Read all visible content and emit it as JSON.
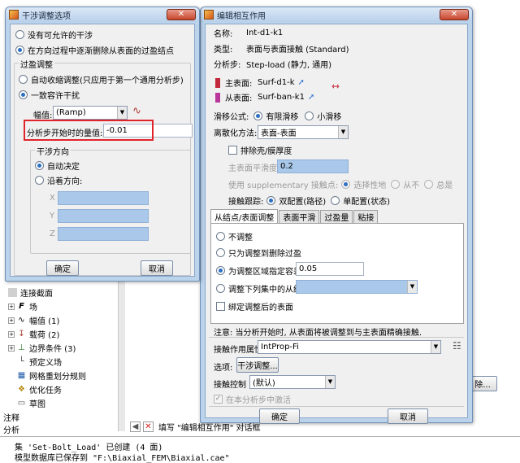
{
  "background": {
    "tree": [
      {
        "label": "连接截面",
        "icon": "connector-section-icon"
      },
      {
        "label": "场",
        "icon": "field-icon"
      },
      {
        "label": "幅值 (1)",
        "icon": "amplitude-icon"
      },
      {
        "label": "载荷 (2)",
        "icon": "load-icon"
      },
      {
        "label": "边界条件 (3)",
        "icon": "bc-icon"
      },
      {
        "label": "预定义场",
        "icon": "predefined-field-icon"
      },
      {
        "label": "网格重划分规则",
        "icon": "remesh-icon"
      },
      {
        "label": "优化任务",
        "icon": "optimization-icon"
      },
      {
        "label": "草图",
        "icon": "sketch-icon"
      }
    ],
    "bottom_labels": [
      "注释",
      "分析"
    ],
    "prompt_text": "填写 \"编辑相互作用\" 对话框",
    "message_lines": [
      "集 'Set-Bolt_Load' 已创建 (4 面)",
      "模型数据库已保存到 \"F:\\Biaxial_FEM\\Biaxial.cae\""
    ],
    "partial_button": "除..."
  },
  "interference_dialog": {
    "title": "干涉调整选项",
    "opt_none": "没有可允许的干涉",
    "opt_gradual": "在方向过程中逐渐删除从表面的过盈结点",
    "overclosure_group": "过盈调整",
    "opt_auto_shrink": "自动收缩调整(只应用于第一个通用分析步)",
    "opt_uniform": "一致容许干扰",
    "amplitude_label": "幅值:",
    "amplitude_value": "(Ramp)",
    "start_value_label": "分析步开始时的量值:",
    "start_value": "-0.01",
    "direction_group": "干涉方向",
    "dir_auto": "自动决定",
    "dir_along": "沿着方向:",
    "x_label": "X",
    "y_label": "Y",
    "z_label": "Z",
    "ok": "确定",
    "cancel": "取消"
  },
  "interaction_dialog": {
    "title": "编辑相互作用",
    "name_label": "名称:",
    "name_value": "Int-d1-k1",
    "type_label": "类型:",
    "type_value": "表面与表面接触 (Standard)",
    "step_label": "分析步:",
    "step_value": "Step-load (静力, 通用)",
    "master_label": "主表面:",
    "master_value": "Surf-d1-k",
    "slave_label": "从表面:",
    "slave_value": "Surf-ban-k1",
    "sliding_label": "滑移公式:",
    "sliding_finite": "有限滑移",
    "sliding_small": "小滑移",
    "discretization_label": "离散化方法:",
    "discretization_value": "表面-表面",
    "exclude_shell": "排除壳/膜厚度",
    "smoothing_label": "主表面平滑度:",
    "smoothing_value": "0.2",
    "supplementary_label": "使用 supplementary 接触点:",
    "supp_selective": "选择性地",
    "supp_never": "从不",
    "supp_always": "总是",
    "tracking_label": "接触跟踪:",
    "tracking_two": "双配置(路径)",
    "tracking_single": "单配置(状态)",
    "tabs": [
      "从结点/表面调整",
      "表面平滑",
      "过盈量",
      "粘接"
    ],
    "adj_none": "不调整",
    "adj_remove": "只为调整到删除过盈",
    "adj_tolerance": "为调整区域指定容差:",
    "adj_tolerance_value": "0.05",
    "adj_nodeset": "调整下列集中的从结点:",
    "tie_surfaces": "绑定调整后的表面",
    "note": "注意:  当分析开始时, 从表面将被调整到与主表面精确接触.",
    "property_label": "接触作用属性:",
    "property_value": "IntProp-Fi",
    "options_label": "选项:",
    "options_button": "干涉调整...",
    "control_label": "接触控制",
    "control_value": "(默认)",
    "activate_label": "在本分析步中激活",
    "ok": "确定",
    "cancel": "取消"
  },
  "colors": {
    "highlight": "#e0242b",
    "selection": "#a9c8ea",
    "accent": "#2b6fc2"
  }
}
